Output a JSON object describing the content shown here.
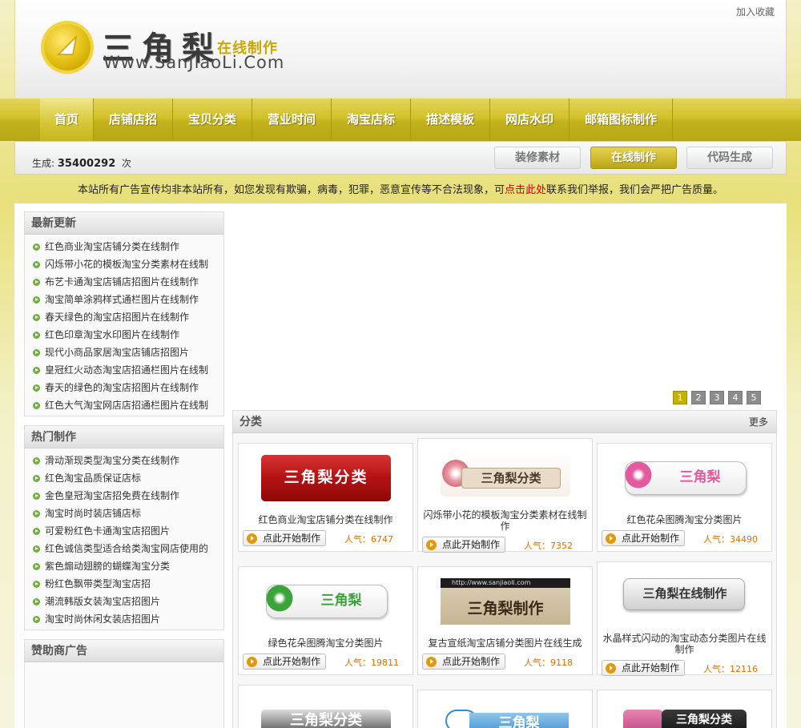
{
  "header": {
    "logo_cn": "三角梨",
    "logo_online": "在线制作",
    "logo_url": "Www.SanJiaoLi.Com",
    "fav_link": "加入收藏"
  },
  "nav": [
    "首页",
    "店铺店招",
    "宝贝分类",
    "营业时间",
    "淘宝店标",
    "描述模板",
    "网店水印",
    "邮箱图标制作"
  ],
  "subbar": {
    "count_label": "生成:",
    "count_value": "35400292",
    "count_unit": "次",
    "tabs": [
      "装修素材",
      "在线制作",
      "代码生成"
    ],
    "active_tab": "在线制作"
  },
  "notice": {
    "before": "本站所有广告宣传均非本站所有，如您发现有欺骗，病毒，犯罪，恶意宣传等不合法现象，可",
    "link": "点击此处",
    "after": "联系我们举报，我们会严把广告质量。"
  },
  "latest": {
    "title": "最新更新",
    "items": [
      "红色商业淘宝店铺分类在线制作",
      "闪烁带小花的模板淘宝分类素材在线制",
      "布艺卡通淘宝店铺店招图片在线制作",
      "淘宝简单涂鸦样式通栏图片在线制作",
      "春天绿色的淘宝店招图片在线制作",
      "红色印章淘宝水印图片在线制作",
      "现代小商品家居淘宝店铺店招图片",
      "皇冠红火动态淘宝店招通栏图片在线制",
      "春天的绿色的淘宝店招图片在线制作",
      "红色大气淘宝网店店招通栏图片在线制"
    ]
  },
  "hot": {
    "title": "热门制作",
    "items": [
      "滑动渐现类型淘宝分类在线制作",
      "红色淘宝品质保证店标",
      "金色皇冠淘宝店招免费在线制作",
      "淘宝时尚时装店铺店标",
      "可爱粉红色卡通淘宝店招图片",
      "红色诚信类型适合给类淘宝网店使用的",
      "紫色煽动翅膀的蝴蝶淘宝分类",
      "粉红色飘带类型淘宝店招",
      "潮流韩版女装淘宝店招图片",
      "淘宝时尚休闲女装店招图片"
    ]
  },
  "sponsor": {
    "title": "赞助商广告"
  },
  "pager": [
    "1",
    "2",
    "3",
    "4",
    "5"
  ],
  "category": {
    "title": "分类",
    "more": "更多",
    "make_label": "点此开始制作",
    "pop_label": "人气：",
    "cards": [
      {
        "title": "红色商业淘宝店铺分类在线制作",
        "pop": "6747",
        "thumb_text": "三角梨分类"
      },
      {
        "title": "闪烁带小花的模板淘宝分类素材在线制作",
        "pop": "7352",
        "thumb_text": "三角梨分类"
      },
      {
        "title": "红色花朵图腾淘宝分类图片",
        "pop": "34490",
        "thumb_text": "三角梨"
      },
      {
        "title": "绿色花朵图腾淘宝分类图片",
        "pop": "19811",
        "thumb_text": "三角梨"
      },
      {
        "title": "复古宣纸淘宝店铺分类图片在线生成",
        "pop": "9118",
        "thumb_text": "三角梨制作",
        "thumb_url": "http://www.sanjiaoli.com"
      },
      {
        "title": "水晶样式闪动的淘宝动态分类图片在线制作",
        "pop": "12116",
        "thumb_text": "三角梨在线制作"
      },
      {
        "thumb_text": "三角梨分类"
      },
      {
        "thumb_text": "三角梨"
      },
      {
        "thumb_text": "三角梨分类"
      }
    ]
  },
  "colors": {
    "accent": "#c9b41e",
    "link_red": "#e00000",
    "pop_orange": "#e07000"
  }
}
